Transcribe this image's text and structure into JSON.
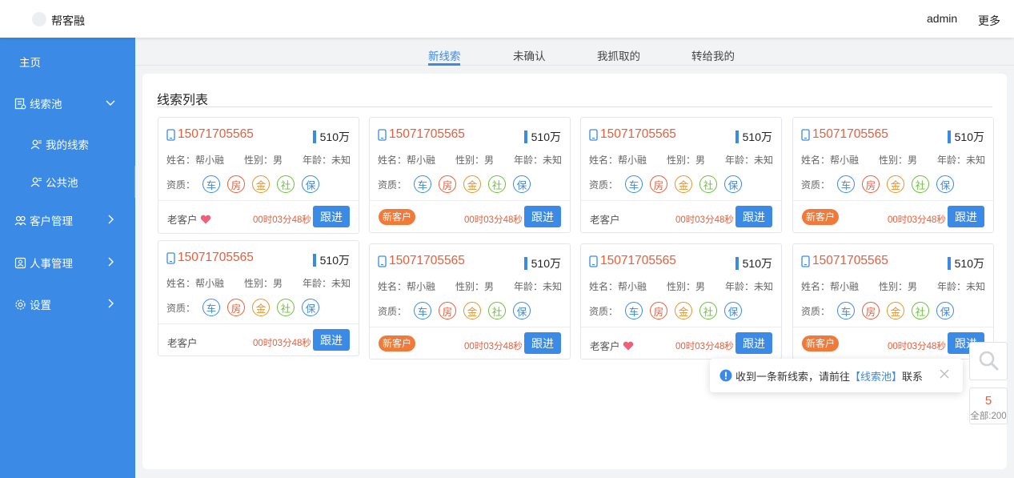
{
  "header": {
    "brand": "帮客融",
    "user": "admin",
    "more": "更多"
  },
  "sidebar": {
    "home": "主页",
    "lead_pool": "线索池",
    "my_leads": "我的线索",
    "public_pool": "公共池",
    "customer_mgmt": "客户管理",
    "hr_mgmt": "人事管理",
    "settings": "设置"
  },
  "tabs": [
    "新线索",
    "未确认",
    "我抓取的",
    "转给我的"
  ],
  "active_tab": "新线索",
  "panel": {
    "title": "线索列表"
  },
  "labels": {
    "name_prefix": "姓名：帮小融",
    "gender": "性别：男",
    "age": "年龄：未知",
    "quals_prefix": "资质：",
    "qual_car": "车",
    "qual_house": "房",
    "qual_gold": "金",
    "qual_social": "社",
    "qual_insurance": "保",
    "old_customer": "老客户",
    "new_customer": "新客户",
    "follow": "跟进"
  },
  "cards": [
    {
      "phone": "15071705565",
      "amount": "510万",
      "timer": "00时03分48秒",
      "customer_type": "老客户",
      "favorite": true
    },
    {
      "phone": "15071705565",
      "amount": "510万",
      "timer": "00时03分48秒",
      "customer_type": "新客户",
      "favorite": false
    },
    {
      "phone": "15071705565",
      "amount": "510万",
      "timer": "00时03分48秒",
      "customer_type": "老客户",
      "favorite": false
    },
    {
      "phone": "15071705565",
      "amount": "510万",
      "timer": "00时03分48秒",
      "customer_type": "新客户",
      "favorite": false
    },
    {
      "phone": "15071705565",
      "amount": "510万",
      "timer": "00时03分48秒",
      "customer_type": "老客户",
      "favorite": false
    },
    {
      "phone": "15071705565",
      "amount": "510万",
      "timer": "00时03分48秒",
      "customer_type": "新客户",
      "favorite": false
    },
    {
      "phone": "15071705565",
      "amount": "510万",
      "timer": "00时03分48秒",
      "customer_type": "老客户",
      "favorite": true
    },
    {
      "phone": "15071705565",
      "amount": "510万",
      "timer": "00时03分48秒",
      "customer_type": "新客户",
      "favorite": false
    }
  ],
  "notification": {
    "before": "收到一条新线索，请前往",
    "link": "【线索池】",
    "after": "联系"
  },
  "counter": {
    "count": "5",
    "total": "全部:200"
  },
  "colors": {
    "primary": "#3a8ae6",
    "accent_red": "#e85d3a",
    "new_tag": "#f07a3a"
  },
  "icons": [
    "phone-icon",
    "heart-icon",
    "search-icon",
    "info-icon",
    "close-icon",
    "list-icon",
    "user-group-icon",
    "gear-icon"
  ]
}
